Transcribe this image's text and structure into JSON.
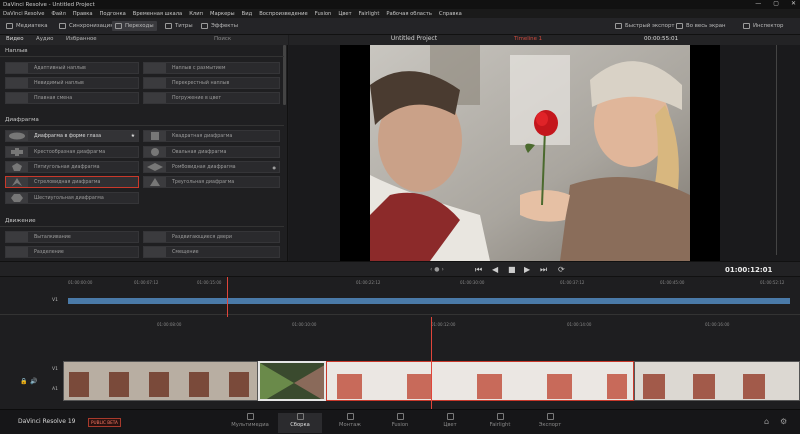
{
  "window": {
    "title": "DaVinci Resolve - Untitled Project",
    "controls": [
      "—",
      "▢",
      "✕"
    ]
  },
  "menu": [
    "DaVinci Resolve",
    "Файл",
    "Правка",
    "Подгонка",
    "Временная шкала",
    "Клип",
    "Маркеры",
    "Вид",
    "Воспроизведение",
    "Fusion",
    "Цвет",
    "Fairlight",
    "Рабочая область",
    "Справка"
  ],
  "toolbar": {
    "media_pool": "Медиатека",
    "sync": "Синхронизация",
    "transitions": "Переходы",
    "titles": "Титры",
    "effects": "Эффекты",
    "quick_export": "Быстрый экспорт",
    "fullscreen": "Во весь экран",
    "inspector": "Инспектор"
  },
  "left_tabs": {
    "video": "Видео",
    "audio": "Аудио",
    "favorites": "Избранное",
    "search": "Поиск"
  },
  "sections": {
    "dissolve": "Наплыв",
    "iris": "Диафрагма",
    "motion": "Движение"
  },
  "dissolve_items": [
    "Адаптивный наплыв",
    "Невидимый наплыв",
    "Плавная смена",
    "Наплыв с размытием",
    "Перекрестный наплыв",
    "Погружение в цвет"
  ],
  "iris_items": [
    "Диафрагма в форме глаза",
    "Крестообразная диафрагма",
    "Пятиугольная диафрагма",
    "Стреловидная диафрагма",
    "Шестиугольная диафрагма",
    "Квадратная диафрагма",
    "Овальная диафрагма",
    "Ромбовидная диафрагма",
    "Треугольная диафрагма"
  ],
  "motion_items": [
    "Выталкивание",
    "Разделение",
    "Раздвигающиеся двери",
    "Смещение"
  ],
  "viewer": {
    "project_title": "Untitled Project",
    "timeline": "Timeline 1",
    "timecode": "00:00:55:01"
  },
  "transport": {
    "timecode": "01:00:12:01"
  },
  "timeline_ruler": [
    "01:00:00:00",
    "01:00:07:12",
    "01:00:15:00",
    "01:00:22:12",
    "01:00:30:00",
    "01:00:37:12",
    "01:00:45:00",
    "01:00:52:12"
  ],
  "timeline_ruler2": [
    "01:00:08:00",
    "01:00:10:00",
    "01:00:12:00",
    "01:00:14:00",
    "01:00:16:00"
  ],
  "tracks": {
    "v1": "V1",
    "a1": "A1"
  },
  "brand": {
    "name": "DaVinci Resolve 19",
    "badge": "PUBLIC BETA"
  },
  "pages": [
    "Мультимедиа",
    "Сборка",
    "Монтаж",
    "Fusion",
    "Цвет",
    "Fairlight",
    "Экспорт"
  ],
  "active_page": "Сборка",
  "colors": {
    "accent": "#e0453a",
    "panel": "#1f1f21",
    "clip_blue": "#4a7aa8"
  }
}
